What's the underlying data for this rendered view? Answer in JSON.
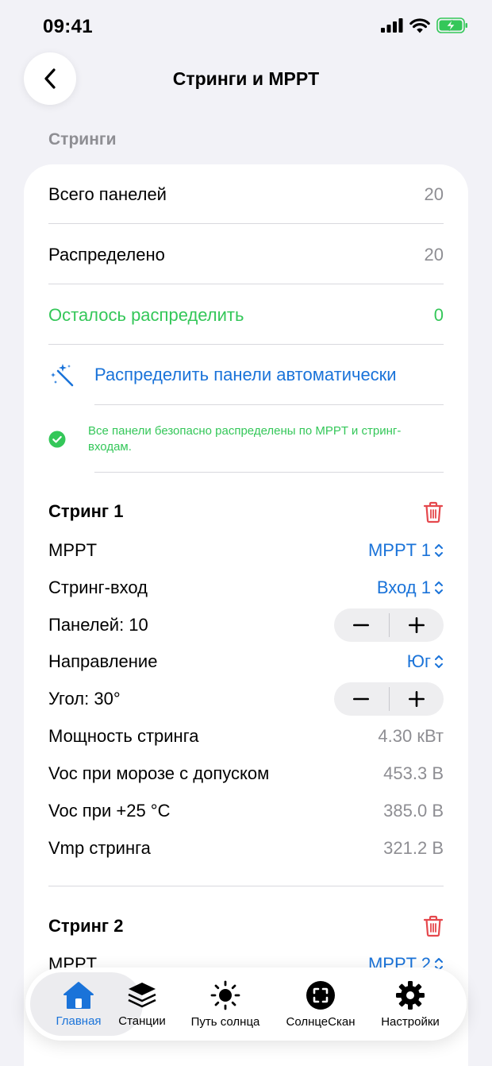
{
  "status": {
    "time": "09:41"
  },
  "nav": {
    "title": "Стринги и MPPT"
  },
  "section": {
    "header": "Стринги"
  },
  "summary": {
    "total_label": "Всего панелей",
    "total_value": "20",
    "distributed_label": "Распределено",
    "distributed_value": "20",
    "remaining_label": "Осталось распределить",
    "remaining_value": "0",
    "auto_label": "Распределить панели автоматически",
    "note": "Все панели безопасно распределены по MPPT и стринг-входам."
  },
  "string1": {
    "title": "Стринг 1",
    "mppt_label": "MPPT",
    "mppt_value": "MPPT 1",
    "input_label": "Стринг-вход",
    "input_value": "Вход 1",
    "panels_label": "Панелей: 10",
    "direction_label": "Направление",
    "direction_value": "Юг",
    "angle_label": "Угол: 30°",
    "power_label": "Мощность стринга",
    "power_value": "4.30 кВт",
    "voc_frost_label": "Voc при морозе с допуском",
    "voc_frost_value": "453.3 В",
    "voc25_label": "Voc при +25 °C",
    "voc25_value": "385.0 В",
    "vmp_label": "Vmp стринга",
    "vmp_value": "321.2 В"
  },
  "string2": {
    "title": "Стринг 2",
    "mppt_label": "MPPT",
    "mppt_value": "MPPT 2"
  },
  "tabs": [
    {
      "label": "Главная",
      "icon": "home-icon",
      "active": true
    },
    {
      "label": "Станции",
      "icon": "layers-icon",
      "active": false
    },
    {
      "label": "Путь солнца",
      "icon": "sun-icon",
      "active": false
    },
    {
      "label": "СолнцеСкан",
      "icon": "scan-icon",
      "active": false
    },
    {
      "label": "Настройки",
      "icon": "gear-icon",
      "active": false
    }
  ],
  "colors": {
    "accent": "#1a73d9",
    "success": "#34c759",
    "danger": "#e5484d",
    "secondary": "#8e8e93"
  }
}
